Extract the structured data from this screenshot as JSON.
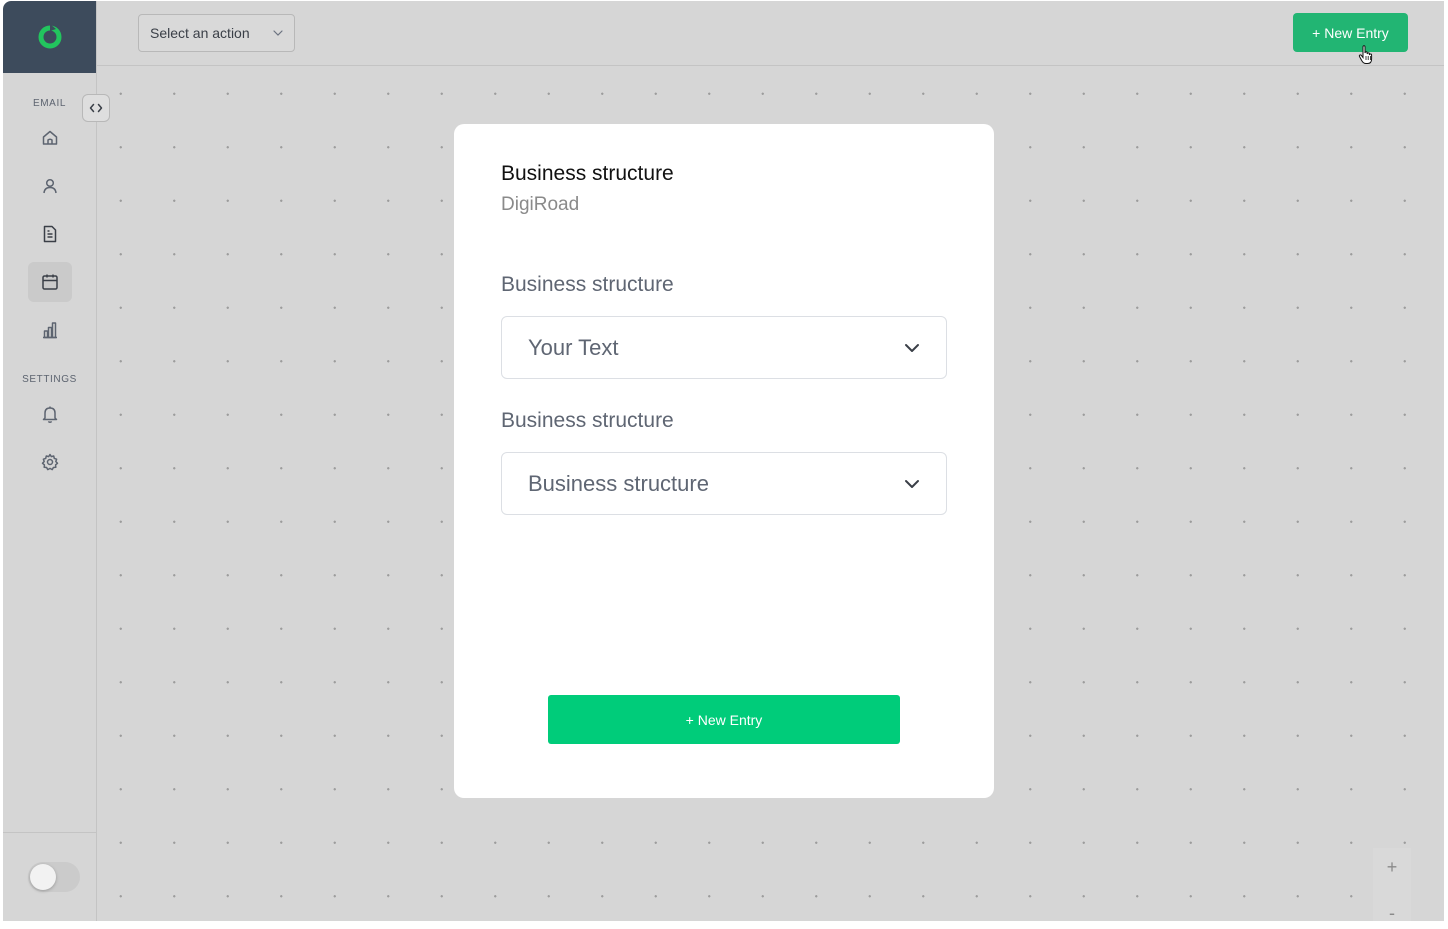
{
  "sidebar": {
    "sections": {
      "email_label": "EMAIL",
      "settings_label": "SETTINGS"
    },
    "email_items": [
      {
        "icon": "home-icon"
      },
      {
        "icon": "user-icon"
      },
      {
        "icon": "document-icon"
      },
      {
        "icon": "calendar-icon",
        "active": true
      },
      {
        "icon": "chart-icon"
      }
    ],
    "settings_items": [
      {
        "icon": "bell-icon"
      },
      {
        "icon": "gear-icon"
      }
    ]
  },
  "topbar": {
    "action_select_label": "Select an action",
    "new_entry_label": "+ New Entry"
  },
  "card": {
    "title": "Business structure",
    "subtitle": "DigiRoad",
    "fields": [
      {
        "label": "Business structure",
        "value": "Your Text"
      },
      {
        "label": "Business structure",
        "value": "Business structure"
      }
    ],
    "new_entry_label": "+ New Entry"
  },
  "zoom": {
    "plus": "+",
    "minus": "-"
  },
  "colors": {
    "brand_green": "#22b573",
    "primary_button": "#00cc7a",
    "sidebar_header": "#3d4b5c",
    "canvas_bg": "#d6d6d6"
  }
}
